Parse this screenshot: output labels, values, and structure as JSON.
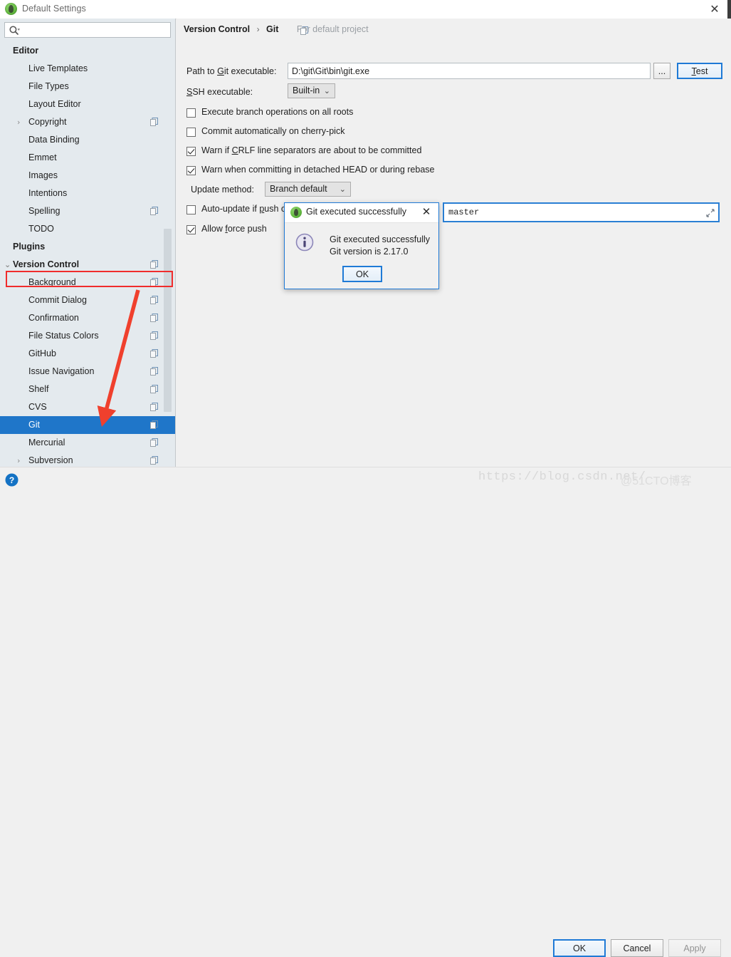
{
  "window": {
    "title": "Default Settings",
    "app_icon": "android-studio-icon",
    "close_label": "✕"
  },
  "search": {
    "value": "",
    "placeholder": "",
    "icon": "search-icon"
  },
  "sidebar": {
    "items": [
      {
        "label": "Editor",
        "level": 0,
        "group": true,
        "arrow": "",
        "copy": false,
        "selected": false
      },
      {
        "label": "Live Templates",
        "level": 1,
        "group": false,
        "arrow": "",
        "copy": false,
        "selected": false
      },
      {
        "label": "File Types",
        "level": 1,
        "group": false,
        "arrow": "",
        "copy": false,
        "selected": false
      },
      {
        "label": "Layout Editor",
        "level": 1,
        "group": false,
        "arrow": "",
        "copy": false,
        "selected": false
      },
      {
        "label": "Copyright",
        "level": 1,
        "group": false,
        "arrow": "›",
        "copy": true,
        "selected": false
      },
      {
        "label": "Data Binding",
        "level": 1,
        "group": false,
        "arrow": "",
        "copy": false,
        "selected": false
      },
      {
        "label": "Emmet",
        "level": 1,
        "group": false,
        "arrow": "",
        "copy": false,
        "selected": false
      },
      {
        "label": "Images",
        "level": 1,
        "group": false,
        "arrow": "",
        "copy": false,
        "selected": false
      },
      {
        "label": "Intentions",
        "level": 1,
        "group": false,
        "arrow": "",
        "copy": false,
        "selected": false
      },
      {
        "label": "Spelling",
        "level": 1,
        "group": false,
        "arrow": "",
        "copy": true,
        "selected": false
      },
      {
        "label": "TODO",
        "level": 1,
        "group": false,
        "arrow": "",
        "copy": false,
        "selected": false
      },
      {
        "label": "Plugins",
        "level": 0,
        "group": true,
        "arrow": "",
        "copy": false,
        "selected": false
      },
      {
        "label": "Version Control",
        "level": 0,
        "group": true,
        "arrow": "⌄",
        "copy": true,
        "selected": false
      },
      {
        "label": "Background",
        "level": 1,
        "group": false,
        "arrow": "",
        "copy": true,
        "selected": false
      },
      {
        "label": "Commit Dialog",
        "level": 1,
        "group": false,
        "arrow": "",
        "copy": true,
        "selected": false
      },
      {
        "label": "Confirmation",
        "level": 1,
        "group": false,
        "arrow": "",
        "copy": true,
        "selected": false
      },
      {
        "label": "File Status Colors",
        "level": 1,
        "group": false,
        "arrow": "",
        "copy": true,
        "selected": false
      },
      {
        "label": "GitHub",
        "level": 1,
        "group": false,
        "arrow": "",
        "copy": true,
        "selected": false
      },
      {
        "label": "Issue Navigation",
        "level": 1,
        "group": false,
        "arrow": "",
        "copy": true,
        "selected": false
      },
      {
        "label": "Shelf",
        "level": 1,
        "group": false,
        "arrow": "",
        "copy": true,
        "selected": false
      },
      {
        "label": "CVS",
        "level": 1,
        "group": false,
        "arrow": "",
        "copy": true,
        "selected": false
      },
      {
        "label": "Git",
        "level": 1,
        "group": false,
        "arrow": "",
        "copy": true,
        "selected": true
      },
      {
        "label": "Mercurial",
        "level": 1,
        "group": false,
        "arrow": "",
        "copy": true,
        "selected": false
      },
      {
        "label": "Subversion",
        "level": 1,
        "group": false,
        "arrow": "›",
        "copy": true,
        "selected": false
      }
    ],
    "annotation": {
      "highlight_target": "Version Control",
      "arrow_target": "Git",
      "color": "#f02c2c"
    }
  },
  "main": {
    "breadcrumb": {
      "root": "Version Control",
      "separator": "›",
      "leaf": "Git",
      "scope_note": "For default project",
      "scope_icon": "copy-scope-icon"
    },
    "git_path": {
      "label_pre": "Path to ",
      "label_mnemonic": "G",
      "label_post": "it executable:",
      "value": "D:\\git\\Git\\bin\\git.exe",
      "browse_label": "...",
      "test_label_pre": "",
      "test_label_mnemonic": "T",
      "test_label_post": "est"
    },
    "ssh": {
      "label_mnemonic": "S",
      "label_post": "SH executable:",
      "value": "Built-in",
      "chevron": "⌄"
    },
    "checkboxes": [
      {
        "label_pre": "Execute branch operations on all roots",
        "mnemonic": "",
        "label_post": "",
        "checked": false
      },
      {
        "label_pre": "Commit automatically on cherry-pick",
        "mnemonic": "",
        "label_post": "",
        "checked": false
      },
      {
        "label_pre": "Warn if ",
        "mnemonic": "C",
        "label_post": "RLF line separators are about to be committed",
        "checked": true
      },
      {
        "label_pre": "Warn when committing in detached HEAD or during rebase",
        "mnemonic": "",
        "label_post": "",
        "checked": true
      }
    ],
    "update_method": {
      "label": "Update method:",
      "value": "Branch default",
      "chevron": "⌄"
    },
    "auto_update": {
      "label_pre": "Auto-update if ",
      "mnemonic": "p",
      "label_post": "ush of the current branch was rejected",
      "checked": false
    },
    "allow_force_push": {
      "label_pre": "Allow ",
      "mnemonic": "f",
      "label_post": "orce push",
      "checked": true
    },
    "protected_branches": {
      "value": "master",
      "expand_icon": "expand-editor-icon"
    }
  },
  "dialog": {
    "icon": "android-studio-icon",
    "title": "Git executed successfully",
    "close_label": "✕",
    "info_icon": "info-icon",
    "message_line1": "Git executed successfully",
    "message_line2": "Git version is 2.17.0",
    "ok_label": "OK"
  },
  "bottom": {
    "help_icon": "help-icon",
    "ok_label": "OK",
    "cancel_label": "Cancel",
    "apply_label": "Apply",
    "watermark_url": "https://blog.csdn.net/",
    "watermark_brand": "@51CTO博客"
  },
  "colors": {
    "accent_blue": "#1f76c9",
    "focus_blue": "#1f7ad6",
    "annotation_red": "#f02c2c",
    "sidebar_bg": "#e4eaee",
    "panel_bg": "#f0f0f0"
  }
}
